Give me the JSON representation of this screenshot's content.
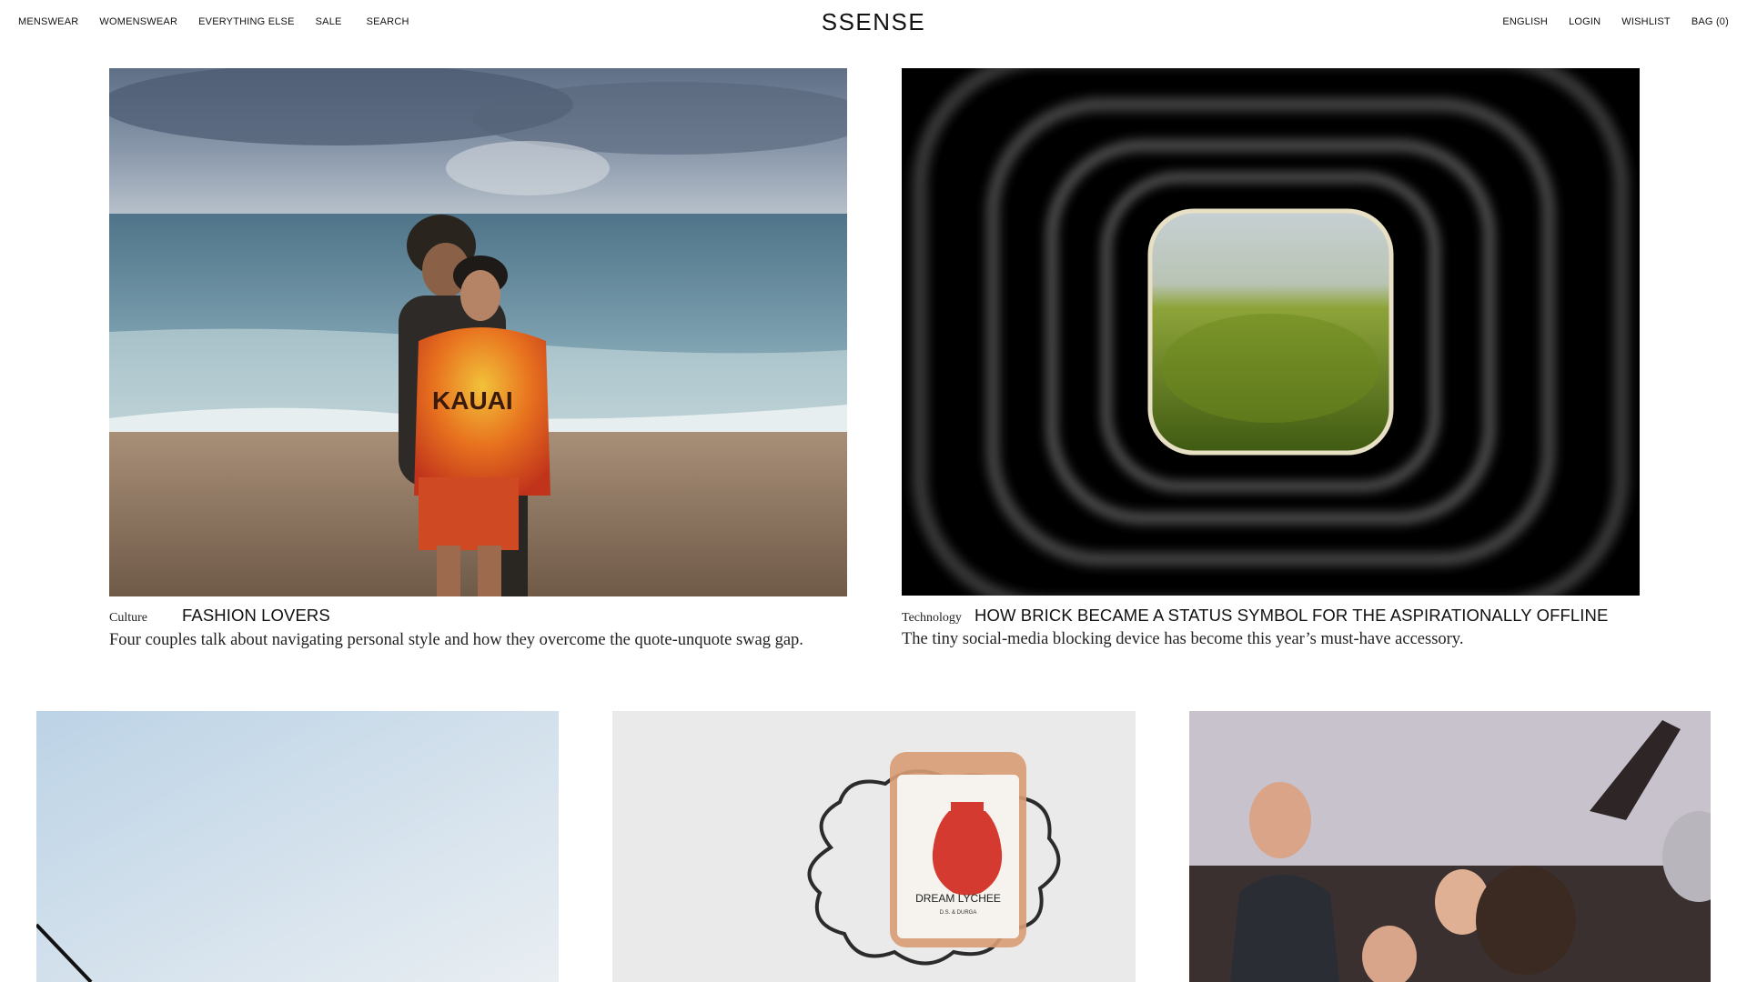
{
  "nav": {
    "left": [
      "MENSWEAR",
      "WOMENSWEAR",
      "EVERYTHING ELSE",
      "SALE",
      "SEARCH"
    ],
    "right": [
      "ENGLISH",
      "LOGIN",
      "WISHLIST",
      "BAG (0)"
    ]
  },
  "logo": "SSENSE",
  "articles": [
    {
      "category": "Culture",
      "title": "FASHION LOVERS",
      "dek": "Four couples talk about navigating personal style and how they overcome the quote-unquote swag gap.",
      "shirt_text": "KAUAI"
    },
    {
      "category": "Technology",
      "title": "HOW BRICK BECAME A STATUS SYMBOL FOR THE ASPIRATIONALLY OFFLINE",
      "dek": "The tiny social-media blocking device has become this year’s must-have accessory."
    }
  ],
  "candle": {
    "name": "DREAM LYCHEE",
    "brand": "D.S. & DURGA"
  },
  "colors": {
    "text": "#111111",
    "background": "#ffffff"
  }
}
